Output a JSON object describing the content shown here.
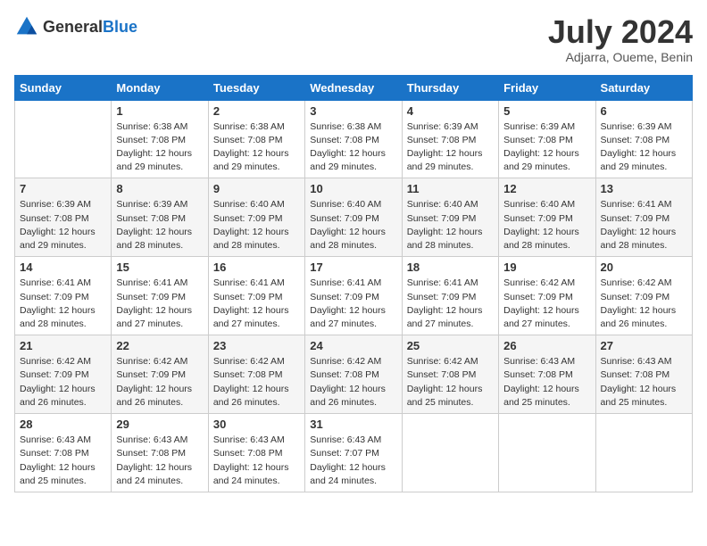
{
  "header": {
    "logo_general": "General",
    "logo_blue": "Blue",
    "month_year": "July 2024",
    "location": "Adjarra, Oueme, Benin"
  },
  "days_of_week": [
    "Sunday",
    "Monday",
    "Tuesday",
    "Wednesday",
    "Thursday",
    "Friday",
    "Saturday"
  ],
  "weeks": [
    [
      {
        "day": "",
        "info": ""
      },
      {
        "day": "1",
        "info": "Sunrise: 6:38 AM\nSunset: 7:08 PM\nDaylight: 12 hours\nand 29 minutes."
      },
      {
        "day": "2",
        "info": "Sunrise: 6:38 AM\nSunset: 7:08 PM\nDaylight: 12 hours\nand 29 minutes."
      },
      {
        "day": "3",
        "info": "Sunrise: 6:38 AM\nSunset: 7:08 PM\nDaylight: 12 hours\nand 29 minutes."
      },
      {
        "day": "4",
        "info": "Sunrise: 6:39 AM\nSunset: 7:08 PM\nDaylight: 12 hours\nand 29 minutes."
      },
      {
        "day": "5",
        "info": "Sunrise: 6:39 AM\nSunset: 7:08 PM\nDaylight: 12 hours\nand 29 minutes."
      },
      {
        "day": "6",
        "info": "Sunrise: 6:39 AM\nSunset: 7:08 PM\nDaylight: 12 hours\nand 29 minutes."
      }
    ],
    [
      {
        "day": "7",
        "info": "Sunrise: 6:39 AM\nSunset: 7:08 PM\nDaylight: 12 hours\nand 29 minutes."
      },
      {
        "day": "8",
        "info": "Sunrise: 6:39 AM\nSunset: 7:08 PM\nDaylight: 12 hours\nand 28 minutes."
      },
      {
        "day": "9",
        "info": "Sunrise: 6:40 AM\nSunset: 7:09 PM\nDaylight: 12 hours\nand 28 minutes."
      },
      {
        "day": "10",
        "info": "Sunrise: 6:40 AM\nSunset: 7:09 PM\nDaylight: 12 hours\nand 28 minutes."
      },
      {
        "day": "11",
        "info": "Sunrise: 6:40 AM\nSunset: 7:09 PM\nDaylight: 12 hours\nand 28 minutes."
      },
      {
        "day": "12",
        "info": "Sunrise: 6:40 AM\nSunset: 7:09 PM\nDaylight: 12 hours\nand 28 minutes."
      },
      {
        "day": "13",
        "info": "Sunrise: 6:41 AM\nSunset: 7:09 PM\nDaylight: 12 hours\nand 28 minutes."
      }
    ],
    [
      {
        "day": "14",
        "info": "Sunrise: 6:41 AM\nSunset: 7:09 PM\nDaylight: 12 hours\nand 28 minutes."
      },
      {
        "day": "15",
        "info": "Sunrise: 6:41 AM\nSunset: 7:09 PM\nDaylight: 12 hours\nand 27 minutes."
      },
      {
        "day": "16",
        "info": "Sunrise: 6:41 AM\nSunset: 7:09 PM\nDaylight: 12 hours\nand 27 minutes."
      },
      {
        "day": "17",
        "info": "Sunrise: 6:41 AM\nSunset: 7:09 PM\nDaylight: 12 hours\nand 27 minutes."
      },
      {
        "day": "18",
        "info": "Sunrise: 6:41 AM\nSunset: 7:09 PM\nDaylight: 12 hours\nand 27 minutes."
      },
      {
        "day": "19",
        "info": "Sunrise: 6:42 AM\nSunset: 7:09 PM\nDaylight: 12 hours\nand 27 minutes."
      },
      {
        "day": "20",
        "info": "Sunrise: 6:42 AM\nSunset: 7:09 PM\nDaylight: 12 hours\nand 26 minutes."
      }
    ],
    [
      {
        "day": "21",
        "info": "Sunrise: 6:42 AM\nSunset: 7:09 PM\nDaylight: 12 hours\nand 26 minutes."
      },
      {
        "day": "22",
        "info": "Sunrise: 6:42 AM\nSunset: 7:09 PM\nDaylight: 12 hours\nand 26 minutes."
      },
      {
        "day": "23",
        "info": "Sunrise: 6:42 AM\nSunset: 7:08 PM\nDaylight: 12 hours\nand 26 minutes."
      },
      {
        "day": "24",
        "info": "Sunrise: 6:42 AM\nSunset: 7:08 PM\nDaylight: 12 hours\nand 26 minutes."
      },
      {
        "day": "25",
        "info": "Sunrise: 6:42 AM\nSunset: 7:08 PM\nDaylight: 12 hours\nand 25 minutes."
      },
      {
        "day": "26",
        "info": "Sunrise: 6:43 AM\nSunset: 7:08 PM\nDaylight: 12 hours\nand 25 minutes."
      },
      {
        "day": "27",
        "info": "Sunrise: 6:43 AM\nSunset: 7:08 PM\nDaylight: 12 hours\nand 25 minutes."
      }
    ],
    [
      {
        "day": "28",
        "info": "Sunrise: 6:43 AM\nSunset: 7:08 PM\nDaylight: 12 hours\nand 25 minutes."
      },
      {
        "day": "29",
        "info": "Sunrise: 6:43 AM\nSunset: 7:08 PM\nDaylight: 12 hours\nand 24 minutes."
      },
      {
        "day": "30",
        "info": "Sunrise: 6:43 AM\nSunset: 7:08 PM\nDaylight: 12 hours\nand 24 minutes."
      },
      {
        "day": "31",
        "info": "Sunrise: 6:43 AM\nSunset: 7:07 PM\nDaylight: 12 hours\nand 24 minutes."
      },
      {
        "day": "",
        "info": ""
      },
      {
        "day": "",
        "info": ""
      },
      {
        "day": "",
        "info": ""
      }
    ]
  ]
}
